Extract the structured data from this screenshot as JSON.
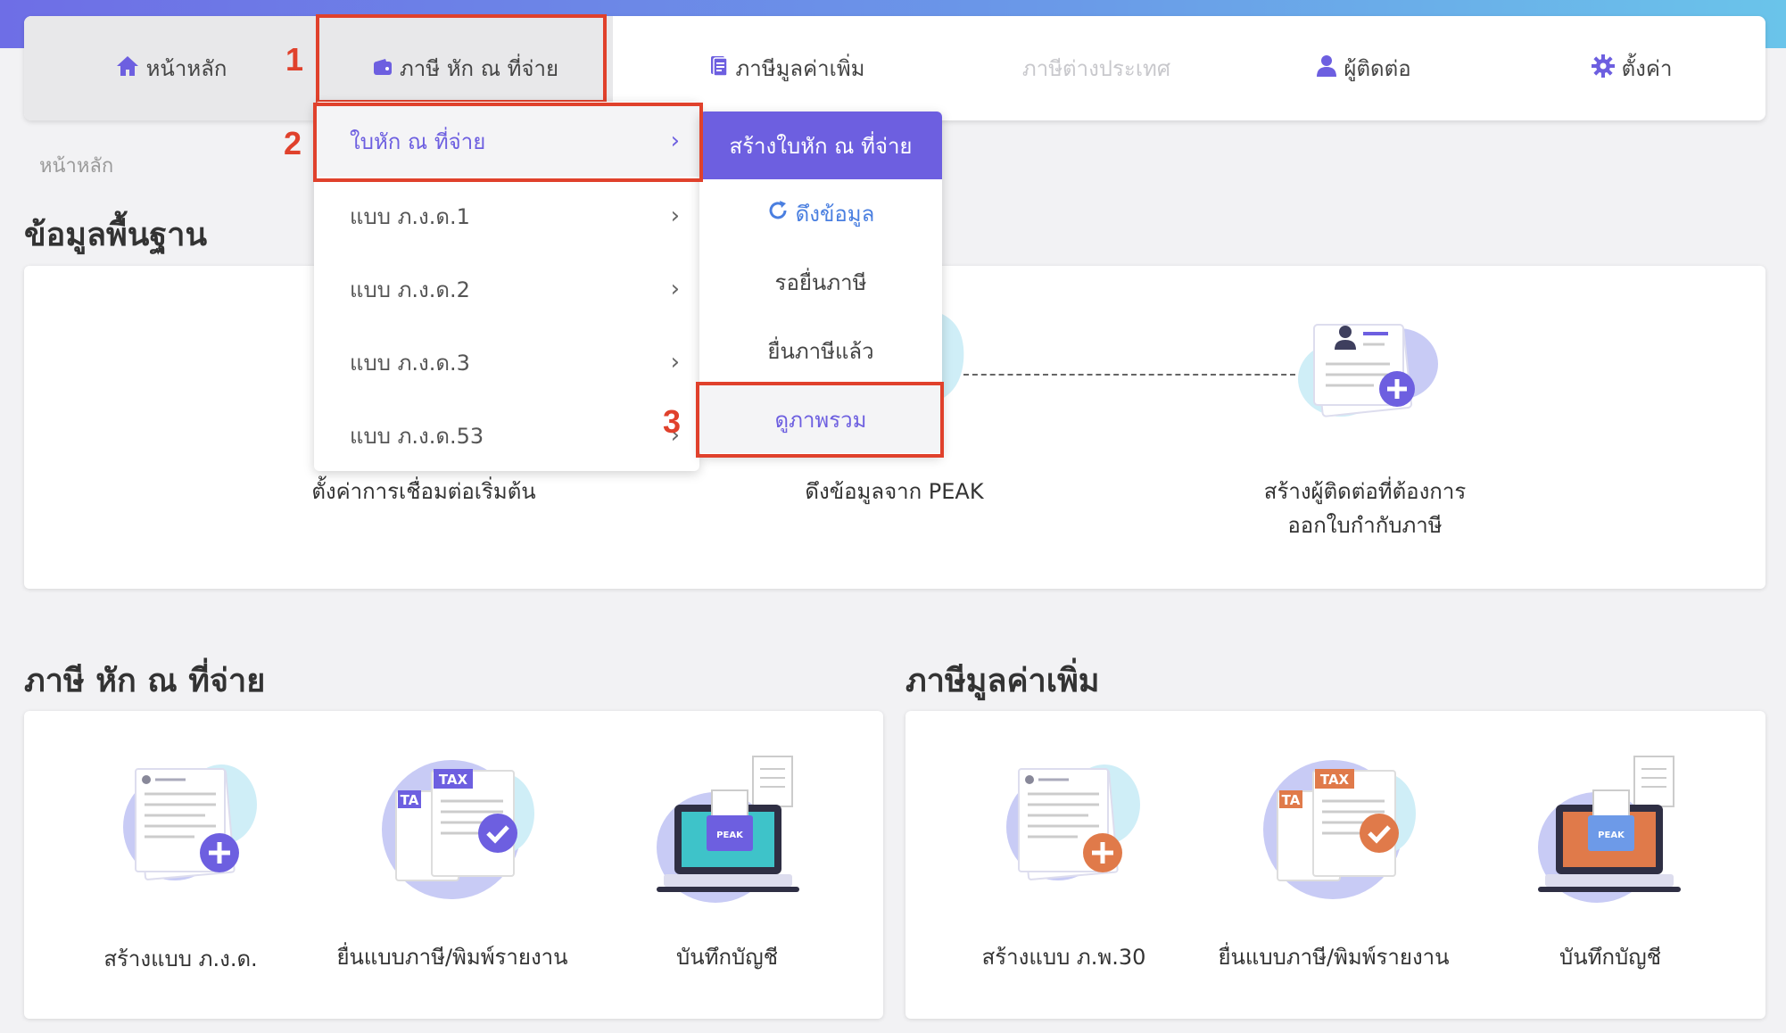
{
  "nav": {
    "home": "หน้าหลัก",
    "wht": "ภาษี หัก ณ ที่จ่าย",
    "vat": "ภาษีมูลค่าเพิ่ม",
    "foreign": "ภาษีต่างประเทศ",
    "contact": "ผู้ติดต่อ",
    "settings": "ตั้งค่า"
  },
  "steps": [
    "1",
    "2",
    "3"
  ],
  "breadcrumb": "หน้าหลัก",
  "dropdown": {
    "items": [
      {
        "label": "ใบหัก ณ ที่จ่าย"
      },
      {
        "label": "แบบ ภ.ง.ด.1"
      },
      {
        "label": "แบบ ภ.ง.ด.2"
      },
      {
        "label": "แบบ ภ.ง.ด.3"
      },
      {
        "label": "แบบ ภ.ง.ด.53"
      }
    ],
    "chevron": "›"
  },
  "submenu": {
    "header": "สร้างใบหัก ณ ที่จ่าย",
    "fetch": "ดึงข้อมูล",
    "pending": "รอยื่นภาษี",
    "filed": "ยื่นภาษีแล้ว",
    "overview": "ดูภาพรวม"
  },
  "basic": {
    "title": "ข้อมูลพื้นฐาน",
    "steps": [
      {
        "label": "ตั้งค่าการเชื่อมต่อเริ่มต้น"
      },
      {
        "label": "ดึงข้อมูลจาก PEAK"
      },
      {
        "label_1": "สร้างผู้ติดต่อที่ต้องการ",
        "label_2": "ออกใบกำกับภาษี"
      }
    ]
  },
  "wht_section": {
    "title": "ภาษี หัก ณ ที่จ่าย",
    "items": [
      {
        "label": "สร้างแบบ ภ.ง.ด."
      },
      {
        "label": "ยื่นแบบภาษี/พิมพ์รายงาน"
      },
      {
        "label": "บันทึกบัญชี"
      }
    ]
  },
  "vat_section": {
    "title": "ภาษีมูลค่าเพิ่ม",
    "items": [
      {
        "label": "สร้างแบบ ภ.พ.30"
      },
      {
        "label": "ยื่นแบบภาษี/พิมพ์รายงาน"
      },
      {
        "label": "บันทึกบัญชี"
      }
    ]
  },
  "illustration_text": {
    "tax": "TAX",
    "ta": "TA",
    "peak": "PEAK"
  },
  "colors": {
    "accent": "#6d5fe0",
    "highlight": "#e0412c",
    "vat_accent": "#e07a4a"
  }
}
